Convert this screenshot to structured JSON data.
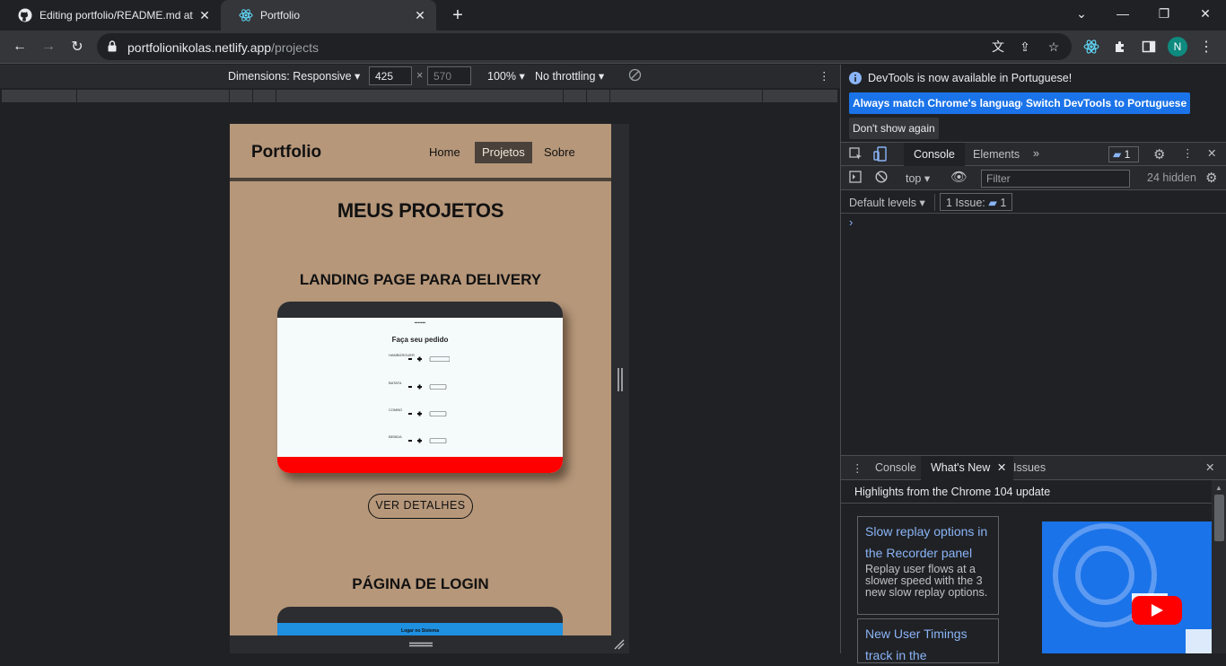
{
  "tabs": [
    {
      "title": "Editing portfolio/README.md at",
      "icon": "github-icon"
    },
    {
      "title": "Portfolio",
      "icon": "react-icon"
    }
  ],
  "address_bar": {
    "host": "portfolionikolas.netlify.app",
    "path": "/projects"
  },
  "profile_initial": "N",
  "device_toolbar": {
    "dimensions_label": "Dimensions: Responsive",
    "width": "425",
    "height": "570",
    "zoom": "100%",
    "throttling": "No throttling"
  },
  "site": {
    "logo": "Portfolio",
    "nav": [
      "Home",
      "Projetos",
      "Sobre"
    ],
    "page_title": "MEUS PROJETOS",
    "projects": [
      {
        "title": "LANDING PAGE PARA DELIVERY",
        "button": "VER DETALHES"
      },
      {
        "title": "PÁGINA DE LOGIN"
      }
    ],
    "screenshot1": {
      "heading": "Faça seu pedido",
      "items": [
        "HAMBÚRGUER",
        "BATATA",
        "COMBO",
        "BEBIDA"
      ]
    },
    "screenshot2": {
      "heading": "Logar no Sistema"
    }
  },
  "devtools": {
    "info_message": "DevTools is now available in Portuguese!",
    "btn_match": "Always match Chrome's language",
    "btn_switch": "Switch DevTools to Portuguese",
    "btn_dont_show": "Don't show again",
    "tabs": [
      "Console",
      "Elements"
    ],
    "issues_badge": "1",
    "context": "top",
    "filter_placeholder": "Filter",
    "hidden_count": "24 hidden",
    "default_levels": "Default levels",
    "issue_label": "1 Issue:",
    "issue_count": "1",
    "drawer_tabs": [
      "Console",
      "What's New",
      "Issues"
    ],
    "drawer_heading": "Highlights from the Chrome 104 update",
    "cards": [
      {
        "title": "Slow replay options in the Recorder panel",
        "body": "Replay user flows at a slower speed with the 3 new slow replay options."
      },
      {
        "title": "New User Timings track in the"
      }
    ]
  },
  "colors": {
    "page_bg": "#b6977a",
    "header_dark": "#4a413a",
    "accent_blue": "#1a73e8",
    "delivery_red": "#ff0000"
  }
}
